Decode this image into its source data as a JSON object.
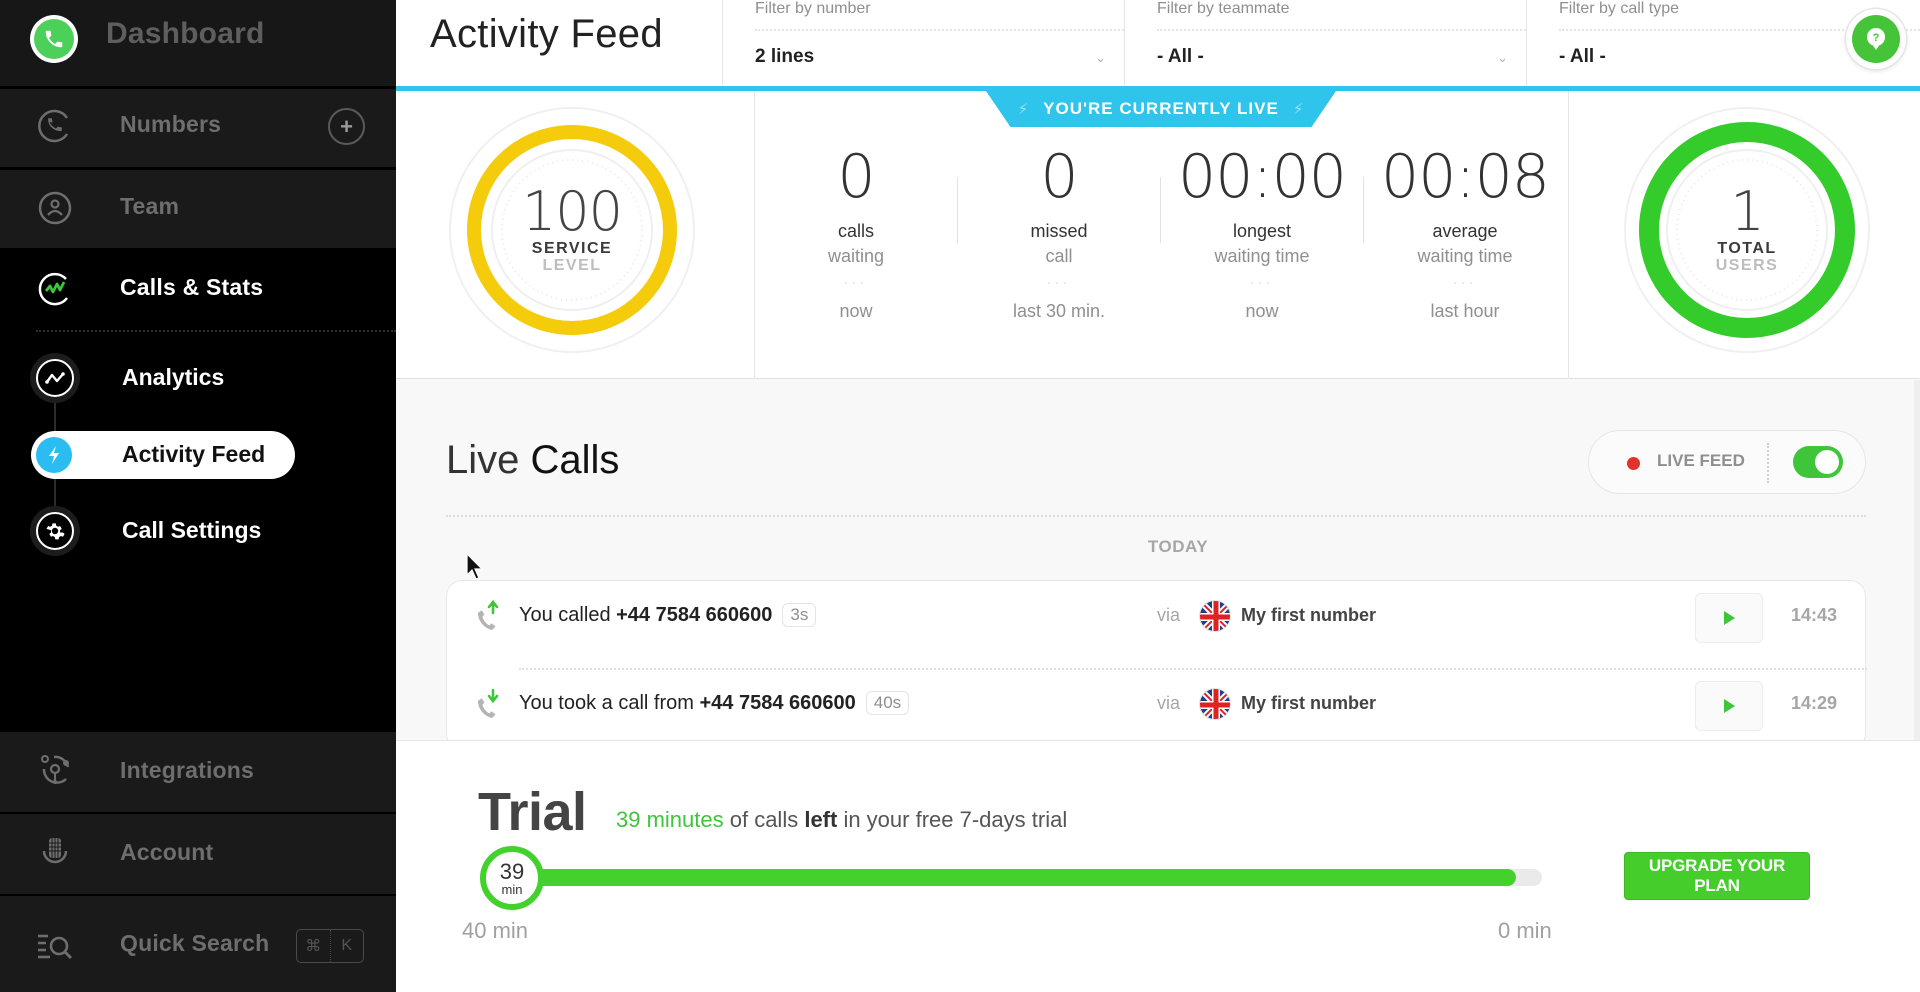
{
  "sidebar": {
    "logo_icon": "phone-icon",
    "dashboard_label": "Dashboard",
    "items": [
      {
        "label": "Numbers",
        "icon": "phone-icon",
        "action": "add-icon"
      },
      {
        "label": "Team",
        "icon": "user-icon"
      },
      {
        "label": "Calls & Stats",
        "icon": "stats-icon"
      }
    ],
    "sub_items": [
      {
        "label": "Analytics",
        "icon": "analytics-icon"
      },
      {
        "label": "Activity Feed",
        "icon": "bolt-icon",
        "active": true
      },
      {
        "label": "Call Settings",
        "icon": "gear-icon"
      }
    ],
    "bottom_items": [
      {
        "label": "Integrations",
        "icon": "integrations-icon"
      },
      {
        "label": "Account",
        "icon": "account-icon"
      },
      {
        "label": "Quick Search",
        "icon": "quick-search-icon",
        "shortcut": [
          "⌘",
          "K"
        ]
      }
    ]
  },
  "header": {
    "title": "Activity Feed",
    "filters": [
      {
        "label": "Filter by number",
        "value": "2 lines"
      },
      {
        "label": "Filter by teammate",
        "value": "- All -"
      },
      {
        "label": "Filter by call type",
        "value": "- All -"
      }
    ],
    "help_icon": "help-icon"
  },
  "live_banner": "YOU'RE CURRENTLY LIVE",
  "stats": {
    "service_level": {
      "value": "100",
      "label1": "SERVICE",
      "label2": "LEVEL",
      "color": "#f5cc0b",
      "fraction": 1.0
    },
    "metrics": [
      {
        "value": "0",
        "label1": "calls",
        "label2": "waiting",
        "period": "now"
      },
      {
        "value": "0",
        "label1": "missed",
        "label2": "call",
        "period": "last 30 min."
      },
      {
        "value": "00:00",
        "label1": "longest",
        "label2": "waiting time",
        "period": "now"
      },
      {
        "value": "00:08",
        "label1": "average",
        "label2": "waiting time",
        "period": "last hour"
      }
    ],
    "total_users": {
      "value": "1",
      "label1": "TOTAL",
      "label2": "USERS",
      "color": "#33cc2a",
      "fraction": 1.0
    }
  },
  "live_calls": {
    "title_light": "Live",
    "title_bold": "Calls",
    "feed_label": "LIVE FEED",
    "feed_enabled": true,
    "day_label": "TODAY",
    "calls": [
      {
        "direction": "outgoing",
        "prefix": "You called",
        "number": "+44 7584 660600",
        "duration": "3s",
        "via": "via",
        "line": "My first number",
        "country": "GB",
        "time": "14:43"
      },
      {
        "direction": "incoming",
        "prefix": "You took a call from",
        "number": "+44 7584 660600",
        "duration": "40s",
        "via": "via",
        "line": "My first number",
        "country": "GB",
        "time": "14:29"
      }
    ]
  },
  "trial": {
    "title": "Trial",
    "minutes_left_text": "39 minutes",
    "text_mid": " of calls ",
    "text_bold": "left",
    "text_end": " in your free 7-days trial",
    "minutes_left": 39,
    "minutes_total": 40,
    "knob_value": "39",
    "knob_unit": "min",
    "start_label": "40 min",
    "end_label": "0 min",
    "upgrade_label": "UPGRADE YOUR PLAN"
  },
  "colors": {
    "accent_blue": "#2ec4ec",
    "brand_green": "#45ce2b",
    "service_yellow": "#f5cc0b",
    "record_red": "#e5312c"
  }
}
